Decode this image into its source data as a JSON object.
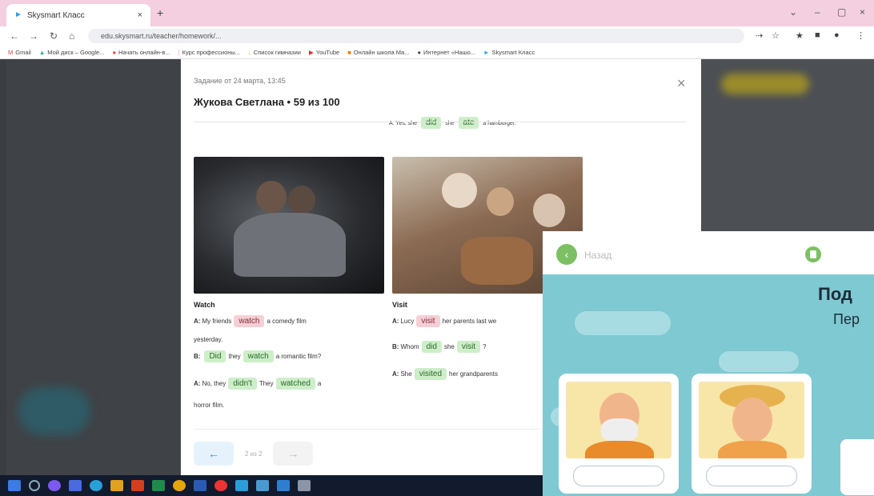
{
  "browser": {
    "tab_title": "Skysmart Класс",
    "tab_close": "×",
    "new_tab": "+",
    "url": "edu.skysmart.ru/teacher/homework/...",
    "bookmarks": [
      "Gmail",
      "Мой диск – Google...",
      "Начать онлайн-в...",
      "Курс профессионы...",
      "Список гимназии",
      "YouTube",
      "Онлайн школа Ма...",
      "Интернет «Нашо...",
      "Skysmart Класс"
    ]
  },
  "modal": {
    "date": "Задание от 24 марта, 13:45",
    "title": "Жукова Светлана • 59 из 100",
    "close": "×",
    "prev_row": {
      "prefix": "A: Yes, she",
      "w1": "did",
      "mid": "she",
      "w2": "ate",
      "suffix": "a hamburger."
    },
    "card1": {
      "title": "Watch",
      "l1": {
        "a": "A:",
        "pre": "My friends",
        "chip": "watch",
        "post": "a comedy film"
      },
      "l1b": "yesterday.",
      "l2": {
        "a": "B:",
        "chip1": "Did",
        "mid": "they",
        "chip2": "watch",
        "post": "a romantic film?"
      },
      "l3": {
        "a": "A:",
        "pre": "No, they",
        "chip1": "didn't",
        "mid": "They",
        "chip2": "watched",
        "post": "a"
      },
      "l3b": "horror film."
    },
    "card2": {
      "title": "Visit",
      "l1": {
        "a": "A:",
        "pre": "Lucy",
        "chip": "visit",
        "post": "her parents last we"
      },
      "l2": {
        "a": "B:",
        "pre": "Whom",
        "chip1": "did",
        "mid": "she",
        "chip2": "visit",
        "post": "?"
      },
      "l3": {
        "a": "A:",
        "pre": "She",
        "chip": "visited",
        "post": "her grandparents"
      }
    },
    "pager": {
      "prev": "←",
      "count": "2 из 2",
      "next": "→"
    }
  },
  "lesson": {
    "back": "Назад",
    "title": "Под",
    "subtitle": "Пер"
  }
}
